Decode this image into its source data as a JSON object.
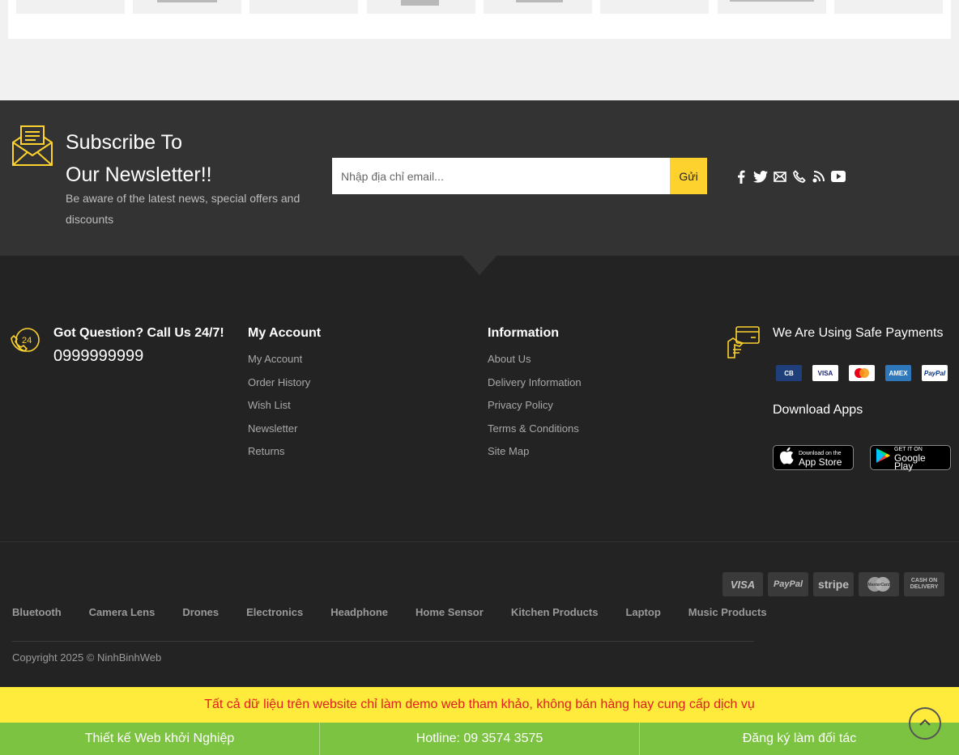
{
  "newsletter": {
    "title_line1": "Subscribe To",
    "title_line2": "Our Newsletter!!",
    "description": "Be aware of the latest news, special offers and discounts",
    "email_placeholder": "Nhập địa chỉ email...",
    "submit_label": "Gửi",
    "socials": [
      "facebook-icon",
      "twitter-icon",
      "email-icon",
      "phone-icon",
      "rss-icon",
      "youtube-icon"
    ]
  },
  "contact": {
    "title": "Got Question? Call Us 24/7!",
    "phone": "0999999999",
    "icon_label": "24"
  },
  "my_account": {
    "title": "My Account",
    "links": [
      "My Account",
      "Order History",
      "Wish List",
      "Newsletter",
      "Returns"
    ]
  },
  "information": {
    "title": "Information",
    "links": [
      "About Us",
      "Delivery Information",
      "Privacy Policy",
      "Terms & Conditions",
      "Site Map"
    ]
  },
  "payments": {
    "title": "We Are Using Safe Payments",
    "cards": [
      {
        "label": "CB",
        "bg": "#1f3f7a",
        "fg": "#ffffff"
      },
      {
        "label": "VISA",
        "bg": "#ffffff",
        "fg": "#1a1f71"
      },
      {
        "label": "MC",
        "bg": "#ffffff",
        "fg": "#eb001b"
      },
      {
        "label": "AMEX",
        "bg": "#2e77bb",
        "fg": "#ffffff"
      },
      {
        "label": "PayPal",
        "bg": "#ffffff",
        "fg": "#003087"
      }
    ]
  },
  "apps": {
    "title": "Download Apps",
    "app_store_small": "Download on the",
    "app_store_big": "App Store",
    "google_small": "GET IT ON",
    "google_big": "Google Play"
  },
  "bottom": {
    "pay_logos": [
      "VISA",
      "PayPal",
      "stripe",
      "MasterCard",
      "CASH ON DELIVERY"
    ],
    "categories": [
      "Bluetooth",
      "Camera Lens",
      "Drones",
      "Electronics",
      "Headphone",
      "Home Sensor",
      "Kitchen Products",
      "Laptop",
      "Music Products"
    ],
    "copyright": "Copyright 2025 © NinhBinhWeb"
  },
  "notice": "Tất cả dữ liệu trên website chỉ làm demo web tham khảo, không bán hàng hay cung cấp dịch vụ",
  "bar": [
    "Thiết kế Web khởi Nghiệp",
    "Hotline: 09 3574 3575",
    "Đăng ký làm đối tác"
  ],
  "colors": {
    "accent": "#fdd22f",
    "notice_bg": "#ffeb3b",
    "notice_text": "#e02020",
    "bar_bg": "#7dc342"
  }
}
